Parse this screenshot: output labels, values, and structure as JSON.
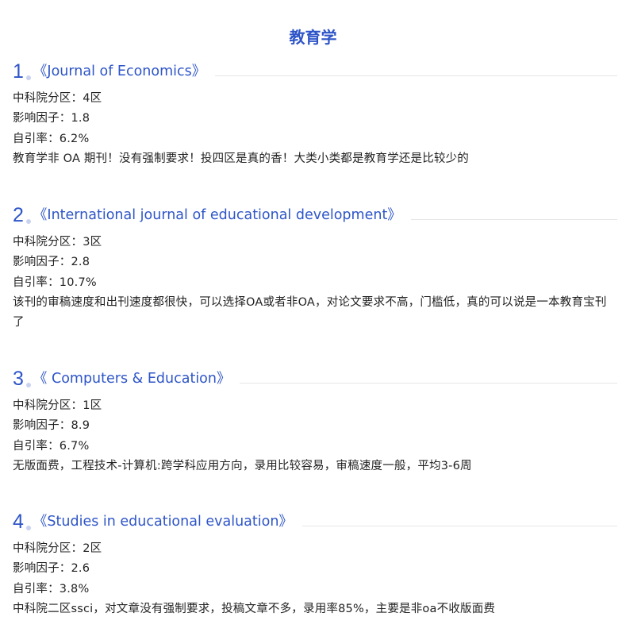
{
  "title": "教育学",
  "sections": [
    {
      "number": "1",
      "journal": "《Journal of Economics》",
      "cas_zone": "中科院分区：4区",
      "impact_factor": "影响因子：1.8",
      "self_citation": "自引率：6.2%",
      "note": "教育学非 OA 期刊！没有强制要求！投四区是真的香！大类小类都是教育学还是比较少的"
    },
    {
      "number": "2",
      "journal": "《International journal of educational development》",
      "cas_zone": "中科院分区：3区",
      "impact_factor": "影响因子：2.8",
      "self_citation": "自引率：10.7%",
      "note": "该刊的审稿速度和出刊速度都很快，可以选择OA或者非OA，对论文要求不高，门槛低，真的可以说是一本教育宝刊了"
    },
    {
      "number": "3",
      "journal": "《 Computers & Education》",
      "cas_zone": "中科院分区：1区",
      "impact_factor": "影响因子：8.9",
      "self_citation": "自引率：6.7%",
      "note": "无版面费，工程技术-计算机:跨学科应用方向，录用比较容易，审稿速度一般，平均3-6周"
    },
    {
      "number": "4",
      "journal": "《Studies in educational evaluation》",
      "cas_zone": "中科院分区：2区",
      "impact_factor": "影响因子：2.6",
      "self_citation": "自引率：3.8%",
      "note": "中科院二区ssci，对文章没有强制要求，投稿文章不多，录用率85%，主要是非oa不收版面费"
    }
  ]
}
